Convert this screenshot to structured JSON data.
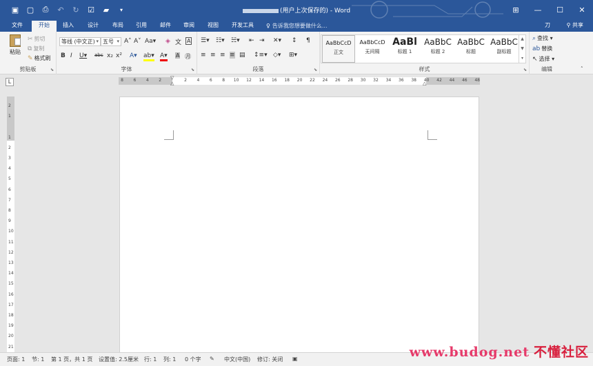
{
  "titlebar": {
    "title_suffix": "(用户上次保存的) - Word",
    "qat_icons": [
      "save-icon",
      "new-doc-icon",
      "print-preview-icon",
      "undo-icon",
      "redo-icon",
      "form-icon",
      "folder-icon",
      "customize-icon"
    ],
    "controls": [
      "ribbon-options-icon",
      "minimize-icon",
      "maximize-icon",
      "close-icon"
    ]
  },
  "tabs": [
    "文件",
    "开始",
    "插入",
    "设计",
    "布局",
    "引用",
    "邮件",
    "审阅",
    "视图",
    "开发工具"
  ],
  "active_tab": "开始",
  "tellme": "告诉我您想要做什么...",
  "sign_in": "刀",
  "share": "共享",
  "ribbon": {
    "clipboard": {
      "label": "剪贴板",
      "paste": "粘贴",
      "cut": "剪切",
      "copy": "复制",
      "format_painter": "格式刷"
    },
    "font": {
      "label": "字体",
      "font_name": "等线 (中文正)",
      "font_size": "五号"
    },
    "paragraph": {
      "label": "段落"
    },
    "styles": {
      "label": "样式",
      "items": [
        {
          "preview": "AaBbCcD",
          "name": "正文"
        },
        {
          "preview": "AaBbCcD",
          "name": "无间隔"
        },
        {
          "preview": "AaBl",
          "name": "标题 1"
        },
        {
          "preview": "AaBbC",
          "name": "标题 2"
        },
        {
          "preview": "AaBbC",
          "name": "标题"
        },
        {
          "preview": "AaBbC",
          "name": "副标题"
        }
      ]
    },
    "editing": {
      "label": "编辑",
      "find": "查找",
      "replace": "替换",
      "select": "选择"
    }
  },
  "ruler": {
    "h_labels": [
      "8",
      "6",
      "4",
      "2",
      "",
      "2",
      "4",
      "6",
      "8",
      "10",
      "12",
      "14",
      "16",
      "18",
      "20",
      "22",
      "24",
      "26",
      "28",
      "30",
      "32",
      "34",
      "36",
      "38",
      "40",
      "42",
      "44",
      "46",
      "48"
    ],
    "v_labels": [
      "2",
      "1",
      "",
      "1",
      "2",
      "3",
      "4",
      "5",
      "6",
      "7",
      "8",
      "9",
      "10",
      "11",
      "12",
      "13",
      "14",
      "15",
      "16",
      "17",
      "18",
      "19",
      "20",
      "21"
    ],
    "tab_selector": "L"
  },
  "statusbar": {
    "page": "页面: 1",
    "section": "节: 1",
    "page_of": "第 1 页，共 1 页",
    "position": "设置值: 2.5厘米",
    "line": "行: 1",
    "column": "列: 1",
    "words": "0 个字",
    "language": "中文(中国)",
    "track_changes": "修订: 关闭"
  },
  "watermark": {
    "url": "www.budog.net",
    "name": "不懂社区"
  },
  "colors": {
    "accent": "#2b579a",
    "ribbon_bg": "#f3f3f3",
    "canvas_bg": "#e6e6e6"
  }
}
